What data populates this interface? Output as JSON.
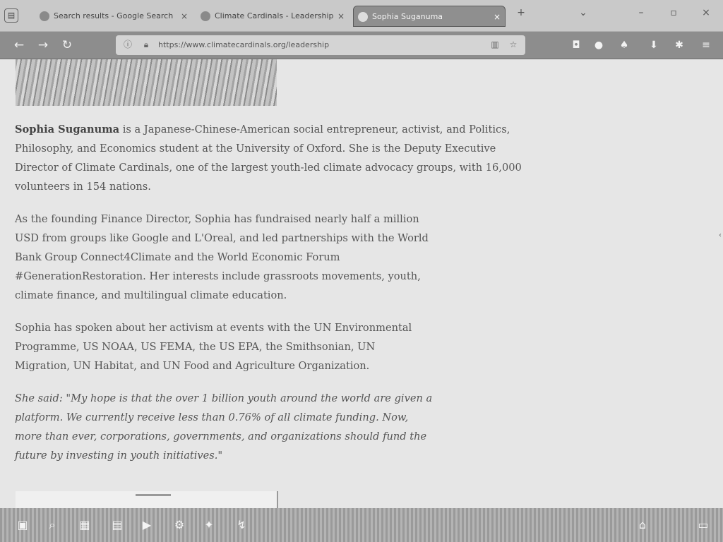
{
  "tabs": [
    {
      "title": "Search results - Google Search",
      "close": "×"
    },
    {
      "title": "Climate Cardinals - Leadership",
      "close": "×"
    },
    {
      "title": "Sophia Suganuma",
      "close": "×"
    }
  ],
  "tabbar_icons": {
    "new_tab": "+",
    "list_tabs": "⌄",
    "minimize": "–",
    "maximize": "▫",
    "close": "×"
  },
  "nav": {
    "back": "←",
    "forward": "→",
    "reload": "↻",
    "url": "https://www.climatecardinals.org/leadership"
  },
  "toolbar_icons": [
    "pocket-icon",
    "account-icon",
    "extensions-icon",
    "downloads-icon",
    "addons-icon",
    "menu-icon"
  ],
  "article": {
    "name": "Sophia Suganuma",
    "p1_rest": " is a Japanese-Chinese-American social entrepreneur, activist, and Politics, Philosophy, and Economics student at the University of Oxford. She is the Deputy Executive Director of Climate Cardinals, one of the largest youth-led climate advocacy groups, with 16,000 volunteers in 154 nations.",
    "p2": "As the founding Finance Director, Sophia has fundraised nearly half a million USD from groups like Google and L'Oreal, and led partnerships with the World Bank Group Connect4Climate and the World Economic Forum #GenerationRestoration. Her interests include grassroots movements, youth, climate finance, and multilingual climate education.",
    "p3": "Sophia has spoken about her activism at events with the UN Environmental Programme, US NOAA, US FEMA, the US EPA, the Smithsonian, UN Migration, UN Habitat, and UN Food and Agriculture Organization.",
    "p4": "She said: \"My hope is that the over 1 billion youth around the world are given a platform. We currently receive less than 0.76% of all climate funding. Now, more than ever, corporations, governments, and organizations should fund the future by investing in youth initiatives.\""
  },
  "taskbar_icons": [
    "files-icon",
    "search-icon",
    "photos-icon",
    "apps-icon",
    "media-icon",
    "settings-icon",
    "network-icon",
    "updates-icon",
    "system-tray-icon",
    "display-icon"
  ],
  "colors": {
    "active_tab": "#8f8f8f",
    "navbar": "#8d8d8d",
    "content_bg": "#e6e6e6"
  }
}
